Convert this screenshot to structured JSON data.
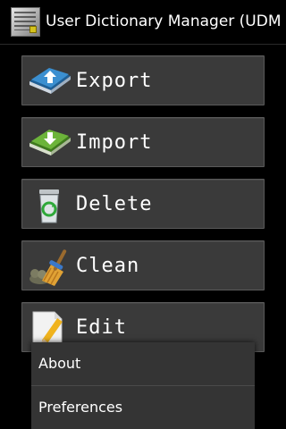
{
  "app": {
    "title": "User Dictionary Manager (UDM…",
    "icon": "dictionary-app-icon"
  },
  "buttons": [
    {
      "label": "Export",
      "icon": "book-export-icon",
      "color": "#2c7fbf"
    },
    {
      "label": "Import",
      "icon": "book-import-icon",
      "color": "#5a9a2a"
    },
    {
      "label": "Delete",
      "icon": "recycle-bin-icon",
      "color": "#3aa83a"
    },
    {
      "label": "Clean",
      "icon": "broom-icon",
      "color": "#d89a2a"
    },
    {
      "label": "Edit",
      "icon": "pencil-paper-icon",
      "color": "#e8b020"
    }
  ],
  "menu": {
    "items": [
      "About",
      "Preferences"
    ]
  }
}
